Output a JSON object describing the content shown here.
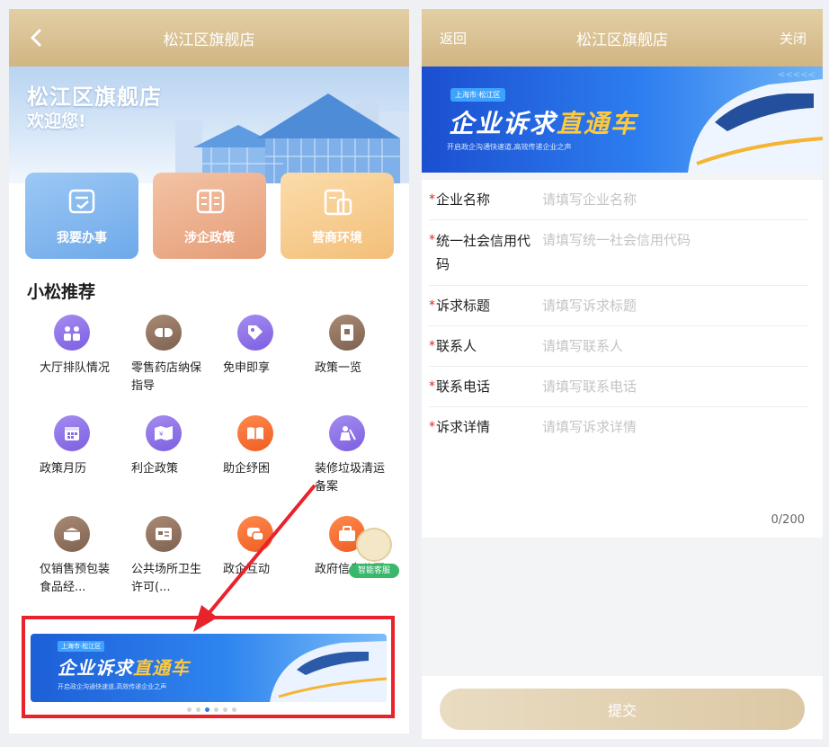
{
  "left": {
    "navbar": {
      "title": "松江区旗舰店"
    },
    "hero": {
      "title": "松江区旗舰店",
      "subtitle": "欢迎您!"
    },
    "quick_actions": [
      {
        "label": "我要办事"
      },
      {
        "label": "涉企政策"
      },
      {
        "label": "营商环境"
      }
    ],
    "section_title": "小松推荐",
    "grid": [
      {
        "label": "大厅排队情况",
        "icon": "people-queue-icon"
      },
      {
        "label": "零售药店纳保指导",
        "icon": "pill-icon"
      },
      {
        "label": "免申即享",
        "icon": "tag-icon"
      },
      {
        "label": "政策一览",
        "icon": "document-icon"
      },
      {
        "label": "政策月历",
        "icon": "calendar-icon"
      },
      {
        "label": "利企政策",
        "icon": "map-icon"
      },
      {
        "label": "助企纾困",
        "icon": "book-icon"
      },
      {
        "label": "装修垃圾清运备案",
        "icon": "worker-icon"
      },
      {
        "label": "仅销售预包装食品经...",
        "icon": "box-icon"
      },
      {
        "label": "公共场所卫生许可(...",
        "icon": "license-icon"
      },
      {
        "label": "政企互动",
        "icon": "chat-icon"
      },
      {
        "label": "政府信息公开",
        "icon": "briefcase-icon"
      }
    ],
    "mascot_badge": "智能客服",
    "banner": {
      "tag": "上海市·松江区",
      "title_part1": "企业诉求",
      "title_part2": "直通车",
      "slogan": "开启政企沟通快速道,高效传递企业之声"
    }
  },
  "right": {
    "navbar": {
      "back": "返回",
      "title": "松江区旗舰店",
      "close": "关闭"
    },
    "banner": {
      "tag": "上海市·松江区",
      "title_part1": "企业诉求",
      "title_part2": "直通车",
      "slogan": "开启政企沟通快速道,高效传递企业之声"
    },
    "form": {
      "company_name": {
        "label": "企业名称",
        "placeholder": "请填写企业名称"
      },
      "credit_code": {
        "label": "统一社会信用代码",
        "placeholder": "请填写统一社会信用代码"
      },
      "appeal_title": {
        "label": "诉求标题",
        "placeholder": "请填写诉求标题"
      },
      "contact": {
        "label": "联系人",
        "placeholder": "请填写联系人"
      },
      "phone": {
        "label": "联系电话",
        "placeholder": "请填写联系电话"
      },
      "details": {
        "label": "诉求详情",
        "placeholder": "请填写诉求详情"
      },
      "counter": "0/200",
      "required_mark": "*"
    },
    "submit_label": "提交"
  },
  "colors": {
    "nav_gold": "#d6bd8c",
    "accent_blue": "#2f7bf0",
    "highlight_red": "#e8232c"
  }
}
